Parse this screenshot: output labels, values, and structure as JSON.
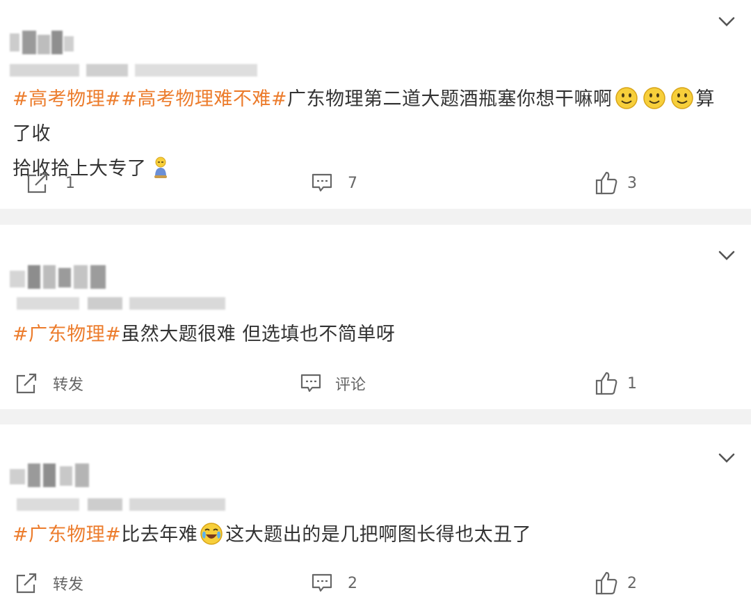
{
  "posts": [
    {
      "tags": [
        "#高考物理#",
        "#高考物理难不难#"
      ],
      "text_a": "广东物理第二道大题酒瓶塞你想干嘛啊",
      "text_b": "算了收",
      "text_c": "拾收拾上大专了",
      "emoji_names": [
        "smile-emoji",
        "smile-emoji",
        "smile-emoji",
        "kneel-emoji"
      ],
      "actions": {
        "repost": "1",
        "comment": "7",
        "like": "3"
      }
    },
    {
      "tags": [
        "#广东物理#"
      ],
      "text_a": "虽然大题很难 但选填也不简单呀",
      "actions": {
        "repost": "转发",
        "comment": "评论",
        "like": "1"
      }
    },
    {
      "tags": [
        "#广东物理#"
      ],
      "text_a": "比去年难",
      "text_b": "这大题出的是几把啊图长得也太丑了",
      "emoji_names": [
        "crying-laugh-emoji"
      ],
      "actions": {
        "repost": "转发",
        "comment": "2",
        "like": "2"
      }
    }
  ],
  "colors": {
    "tag": "#ec7c2c",
    "text": "#333333",
    "divider": "#f2f2f2"
  },
  "icons": [
    "chevron-down-icon",
    "repost-icon",
    "comment-icon",
    "like-icon"
  ]
}
